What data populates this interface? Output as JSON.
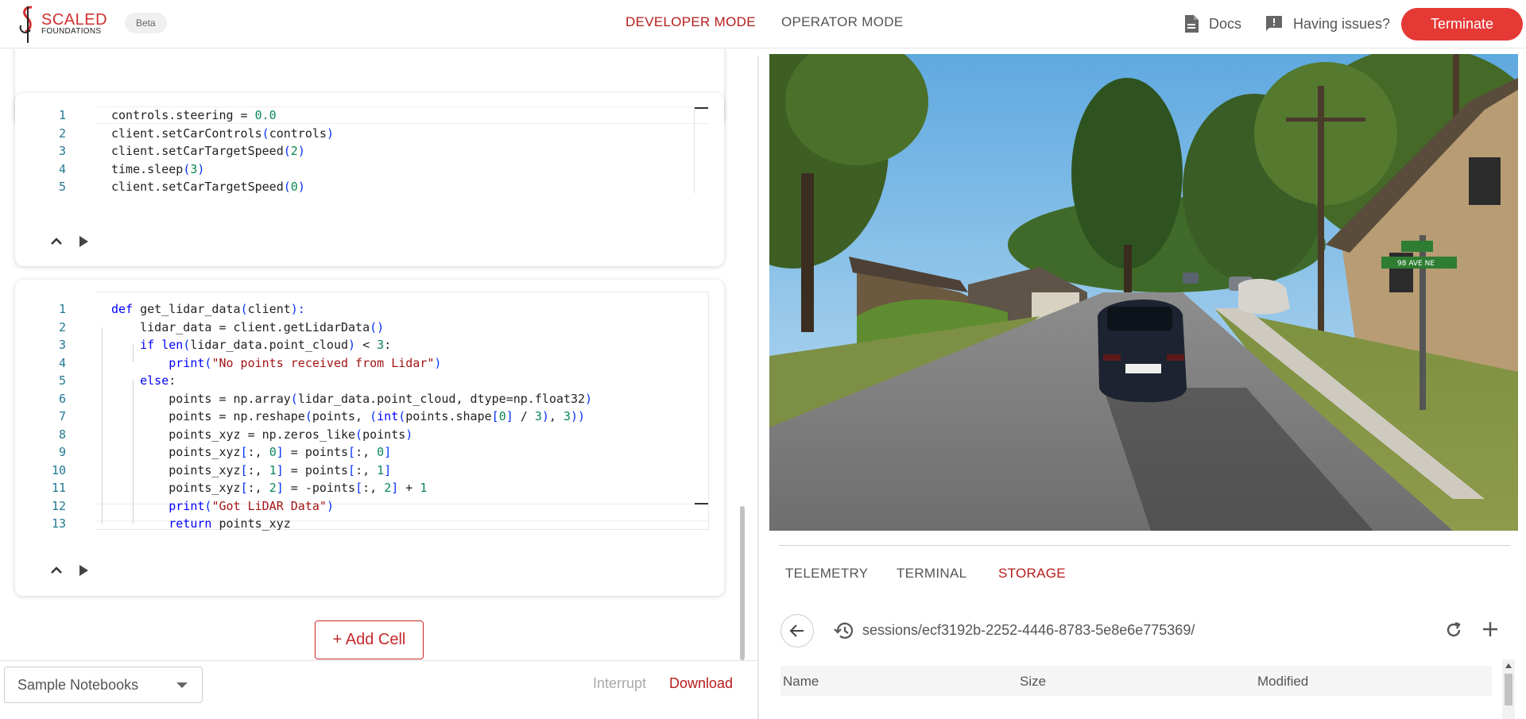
{
  "header": {
    "logo_line1": "SCALED",
    "logo_line2": "FOUNDATIONS",
    "beta": "Beta",
    "developer_mode": "DEVELOPER MODE",
    "operator_mode": "OPERATOR MODE",
    "docs": "Docs",
    "issues": "Having issues?",
    "terminate": "Terminate",
    "brand_color": "#e53935",
    "active_color": "#b71c1c"
  },
  "cells": [
    {
      "lines": [
        {
          "n": "1",
          "code": [
            [
              "fn",
              "controls.steering = "
            ],
            [
              "num",
              "0.0"
            ]
          ]
        },
        {
          "n": "2",
          "code": [
            [
              "fn",
              "client.setCarControls"
            ],
            [
              "br",
              "("
            ],
            [
              "fn",
              "controls"
            ],
            [
              "br",
              ")"
            ]
          ]
        },
        {
          "n": "3",
          "code": [
            [
              "fn",
              "client.setCarTargetSpeed"
            ],
            [
              "br",
              "("
            ],
            [
              "num",
              "2"
            ],
            [
              "br",
              ")"
            ]
          ]
        },
        {
          "n": "4",
          "code": [
            [
              "fn",
              "time.sleep"
            ],
            [
              "br",
              "("
            ],
            [
              "num",
              "3"
            ],
            [
              "br",
              ")"
            ]
          ]
        },
        {
          "n": "5",
          "code": [
            [
              "fn",
              "client.setCarTargetSpeed"
            ],
            [
              "br",
              "("
            ],
            [
              "num",
              "0"
            ],
            [
              "br",
              ")"
            ]
          ]
        }
      ]
    },
    {
      "lines": [
        {
          "n": "1",
          "code": [
            [
              "kw",
              "def "
            ],
            [
              "fn",
              "get_lidar_data"
            ],
            [
              "br",
              "("
            ],
            [
              "fn",
              "client"
            ],
            [
              "br",
              "):"
            ]
          ]
        },
        {
          "n": "2",
          "code": [
            [
              "fn",
              "    lidar_data = client.getLidarData"
            ],
            [
              "br",
              "()"
            ]
          ]
        },
        {
          "n": "3",
          "code": [
            [
              "kw",
              "    if "
            ],
            [
              "kw",
              "len"
            ],
            [
              "br",
              "("
            ],
            [
              "fn",
              "lidar_data.point_cloud"
            ],
            [
              "br",
              ")"
            ],
            [
              "fn",
              " < "
            ],
            [
              "num",
              "3"
            ],
            [
              "fn",
              ":"
            ]
          ]
        },
        {
          "n": "4",
          "code": [
            [
              "fn",
              "        "
            ],
            [
              "kw",
              "print"
            ],
            [
              "br",
              "("
            ],
            [
              "str",
              "\"No points received from Lidar\""
            ],
            [
              "br",
              ")"
            ]
          ]
        },
        {
          "n": "5",
          "code": [
            [
              "kw",
              "    else"
            ],
            [
              "fn",
              ":"
            ]
          ]
        },
        {
          "n": "6",
          "code": [
            [
              "fn",
              "        points = np.array"
            ],
            [
              "br",
              "("
            ],
            [
              "fn",
              "lidar_data.point_cloud, dtype=np.float32"
            ],
            [
              "br",
              ")"
            ]
          ]
        },
        {
          "n": "7",
          "code": [
            [
              "fn",
              "        points = np.reshape"
            ],
            [
              "br",
              "("
            ],
            [
              "fn",
              "points, "
            ],
            [
              "br",
              "("
            ],
            [
              "kw",
              "int"
            ],
            [
              "br",
              "("
            ],
            [
              "fn",
              "points.shape"
            ],
            [
              "br",
              "["
            ],
            [
              "num",
              "0"
            ],
            [
              "br",
              "]"
            ],
            [
              "fn",
              " / "
            ],
            [
              "num",
              "3"
            ],
            [
              "br",
              ")"
            ],
            [
              "fn",
              ", "
            ],
            [
              "num",
              "3"
            ],
            [
              "br",
              "))"
            ]
          ]
        },
        {
          "n": "8",
          "code": [
            [
              "fn",
              "        points_xyz = np.zeros_like"
            ],
            [
              "br",
              "("
            ],
            [
              "fn",
              "points"
            ],
            [
              "br",
              ")"
            ]
          ]
        },
        {
          "n": "9",
          "code": [
            [
              "fn",
              "        points_xyz"
            ],
            [
              "br",
              "["
            ],
            [
              "fn",
              ":, "
            ],
            [
              "num",
              "0"
            ],
            [
              "br",
              "]"
            ],
            [
              "fn",
              " = points"
            ],
            [
              "br",
              "["
            ],
            [
              "fn",
              ":, "
            ],
            [
              "num",
              "0"
            ],
            [
              "br",
              "]"
            ]
          ]
        },
        {
          "n": "10",
          "code": [
            [
              "fn",
              "        points_xyz"
            ],
            [
              "br",
              "["
            ],
            [
              "fn",
              ":, "
            ],
            [
              "num",
              "1"
            ],
            [
              "br",
              "]"
            ],
            [
              "fn",
              " = points"
            ],
            [
              "br",
              "["
            ],
            [
              "fn",
              ":, "
            ],
            [
              "num",
              "1"
            ],
            [
              "br",
              "]"
            ]
          ]
        },
        {
          "n": "11",
          "code": [
            [
              "fn",
              "        points_xyz"
            ],
            [
              "br",
              "["
            ],
            [
              "fn",
              ":, "
            ],
            [
              "num",
              "2"
            ],
            [
              "br",
              "]"
            ],
            [
              "fn",
              " = -points"
            ],
            [
              "br",
              "["
            ],
            [
              "fn",
              ":, "
            ],
            [
              "num",
              "2"
            ],
            [
              "br",
              "]"
            ],
            [
              "fn",
              " + "
            ],
            [
              "num",
              "1"
            ]
          ]
        },
        {
          "n": "12",
          "code": [
            [
              "fn",
              "        "
            ],
            [
              "kw",
              "print"
            ],
            [
              "br",
              "("
            ],
            [
              "str",
              "\"Got LiDAR Data\""
            ],
            [
              "br",
              ")"
            ]
          ]
        },
        {
          "n": "13",
          "code": [
            [
              "kw",
              "        return "
            ],
            [
              "fn",
              "points_xyz"
            ]
          ]
        }
      ]
    }
  ],
  "add_cell": "+ Add Cell",
  "footer": {
    "sample_notebooks": "Sample Notebooks",
    "interrupt": "Interrupt",
    "download": "Download"
  },
  "right": {
    "tabs": [
      "TELEMETRY",
      "TERMINAL",
      "STORAGE"
    ],
    "active_tab": "STORAGE",
    "path": "sessions/ecf3192b-2252-4446-8783-5e8e6e775369/",
    "columns": [
      "Name",
      "Size",
      "Modified"
    ],
    "street_sign": "98 AVE NE"
  }
}
